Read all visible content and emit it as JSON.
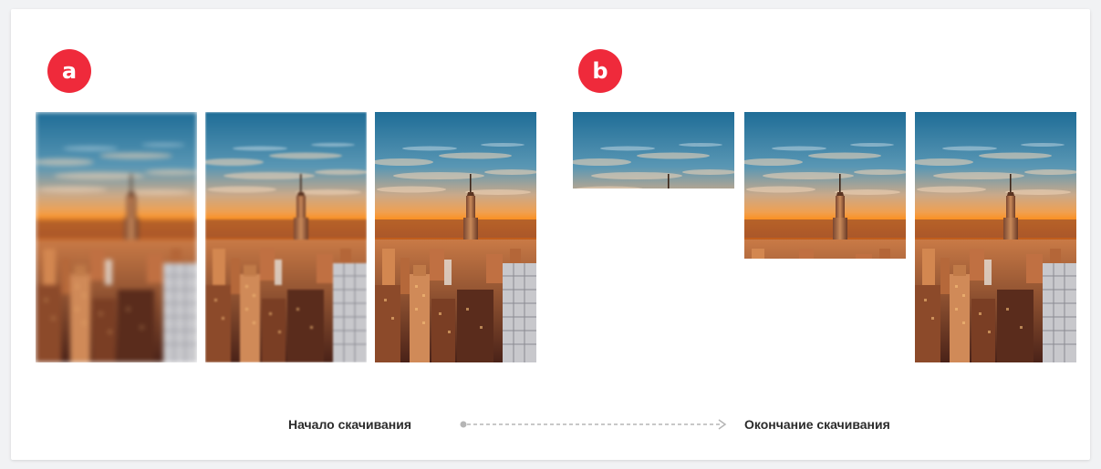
{
  "panels": [
    {
      "badge": "a"
    },
    {
      "badge": "b"
    }
  ],
  "timeline": {
    "start_label": "Начало скачивания",
    "end_label": "Окончание скачивания"
  },
  "colors": {
    "badge": "#ef2a3b",
    "sky_top": "#2b7fa6",
    "horizon_orange": "#ff8a10",
    "arrow": "#b5b5b5"
  },
  "frames": {
    "a": [
      {
        "state": "very-blurry"
      },
      {
        "state": "slightly-blurry"
      },
      {
        "state": "sharp"
      }
    ],
    "b": [
      {
        "loaded_fraction": 0.3
      },
      {
        "loaded_fraction": 0.58
      },
      {
        "loaded_fraction": 1.0
      }
    ]
  }
}
